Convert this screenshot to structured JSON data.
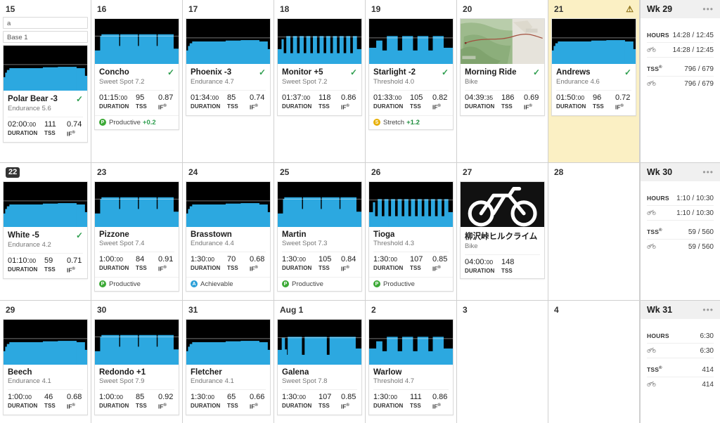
{
  "app": {
    "name": "training-calendar"
  },
  "colors": {
    "graph_bg": "#000000",
    "power_blue": "#2ca8e0",
    "today_highlight": "#fbf0c4",
    "check_green": "#2e9e4f",
    "productive": "#3ba935",
    "achievable": "#2a9fd8",
    "stretch": "#e8b007",
    "warning": "#8a6d12"
  },
  "icons": {
    "check": "✓",
    "warning": "⚠",
    "menu": "•••",
    "bike": "bicycle-icon"
  },
  "labels": {
    "duration": "DURATION",
    "tss": "TSS",
    "if": "IF",
    "if_sup": "®",
    "hours": "HOURS",
    "tss_sup": "®"
  },
  "weeks": [
    {
      "summary": {
        "title": "Wk 29",
        "rows": [
          {
            "label": "HOURS",
            "icon": null,
            "value": "14:28 / 12:45"
          },
          {
            "label": null,
            "icon": "bicycle-icon",
            "value": "14:28 / 12:45"
          },
          {
            "label": "TSS",
            "icon": null,
            "value": "796 / 679",
            "sup": true
          },
          {
            "label": null,
            "icon": "bicycle-icon",
            "value": "796 / 679"
          }
        ]
      },
      "days": [
        {
          "date": "15",
          "today": false,
          "highlight": false,
          "warning": false,
          "annotations": [
            "a",
            "Base 1"
          ],
          "workout": {
            "title": "Polar Bear -3",
            "subtitle": "Endurance 5.6",
            "completed": true,
            "duration": "02:00:",
            "duration_sec": "00",
            "tss": "111",
            "if": "0.74",
            "graph": "endurance-steady",
            "footer": null
          }
        },
        {
          "date": "16",
          "today": false,
          "highlight": false,
          "warning": false,
          "annotations": [],
          "workout": {
            "title": "Concho",
            "subtitle": "Sweet Spot 7.2",
            "completed": true,
            "duration": "01:15:",
            "duration_sec": "00",
            "tss": "95",
            "if": "0.87",
            "graph": "sweetspot-blocks",
            "footer": {
              "type": "Productive",
              "delta": "+0.2",
              "dot": "green"
            }
          }
        },
        {
          "date": "17",
          "today": false,
          "highlight": false,
          "warning": false,
          "annotations": [],
          "workout": {
            "title": "Phoenix -3",
            "subtitle": "Endurance 4.7",
            "completed": true,
            "duration": "01:34:",
            "duration_sec": "00",
            "tss": "85",
            "if": "0.74",
            "graph": "endurance-steady",
            "footer": null
          }
        },
        {
          "date": "18",
          "today": false,
          "highlight": false,
          "warning": false,
          "annotations": [],
          "workout": {
            "title": "Monitor +5",
            "subtitle": "Sweet Spot 7.2",
            "completed": true,
            "duration": "01:37:",
            "duration_sec": "00",
            "tss": "118",
            "if": "0.86",
            "graph": "intervals-narrow",
            "footer": null
          }
        },
        {
          "date": "19",
          "today": false,
          "highlight": false,
          "warning": false,
          "annotations": [],
          "workout": {
            "title": "Starlight -2",
            "subtitle": "Threshold 4.0",
            "completed": true,
            "duration": "01:33:",
            "duration_sec": "00",
            "tss": "105",
            "if": "0.82",
            "graph": "threshold-wide",
            "footer": {
              "type": "Stretch",
              "delta": "+1.2",
              "dot": "amber"
            }
          }
        },
        {
          "date": "20",
          "today": false,
          "highlight": false,
          "warning": false,
          "annotations": [],
          "workout": {
            "title": "Morning Ride",
            "subtitle": "Bike",
            "completed": true,
            "duration": "04:39:",
            "duration_sec": "35",
            "tss": "186",
            "if": "0.69",
            "graph": "map",
            "footer": null
          }
        },
        {
          "date": "21",
          "today": false,
          "highlight": true,
          "warning": true,
          "annotations": [],
          "workout": {
            "title": "Andrews",
            "subtitle": "Endurance 4.6",
            "completed": true,
            "duration": "01:50:",
            "duration_sec": "00",
            "tss": "96",
            "if": "0.72",
            "graph": "endurance-steady",
            "footer": null
          }
        }
      ]
    },
    {
      "summary": {
        "title": "Wk 30",
        "rows": [
          {
            "label": "HOURS",
            "icon": null,
            "value": "1:10 / 10:30"
          },
          {
            "label": null,
            "icon": "bicycle-icon",
            "value": "1:10 / 10:30"
          },
          {
            "label": "TSS",
            "icon": null,
            "value": "59 / 560",
            "sup": true
          },
          {
            "label": null,
            "icon": "bicycle-icon",
            "value": "59 / 560"
          }
        ]
      },
      "days": [
        {
          "date": "22",
          "today": true,
          "highlight": false,
          "warning": false,
          "annotations": [],
          "workout": {
            "title": "White -5",
            "subtitle": "Endurance 4.2",
            "completed": true,
            "duration": "01:10:",
            "duration_sec": "00",
            "tss": "59",
            "if": "0.71",
            "graph": "endurance-steady",
            "footer": null
          }
        },
        {
          "date": "23",
          "today": false,
          "highlight": false,
          "warning": false,
          "annotations": [],
          "workout": {
            "title": "Pizzone",
            "subtitle": "Sweet Spot 7.4",
            "completed": false,
            "duration": "1:00:",
            "duration_sec": "00",
            "tss": "84",
            "if": "0.91",
            "graph": "sweetspot-blocks",
            "footer": {
              "type": "Productive",
              "delta": null,
              "dot": "green"
            }
          }
        },
        {
          "date": "24",
          "today": false,
          "highlight": false,
          "warning": false,
          "annotations": [],
          "workout": {
            "title": "Brasstown",
            "subtitle": "Endurance 4.4",
            "completed": false,
            "duration": "1:30:",
            "duration_sec": "00",
            "tss": "70",
            "if": "0.68",
            "graph": "endurance-steady",
            "footer": {
              "type": "Achievable",
              "delta": null,
              "dot": "blue"
            }
          }
        },
        {
          "date": "25",
          "today": false,
          "highlight": false,
          "warning": false,
          "annotations": [],
          "workout": {
            "title": "Martin",
            "subtitle": "Sweet Spot 7.3",
            "completed": false,
            "duration": "1:30:",
            "duration_sec": "00",
            "tss": "105",
            "if": "0.84",
            "graph": "sweetspot-blocks",
            "footer": {
              "type": "Productive",
              "delta": null,
              "dot": "green"
            }
          }
        },
        {
          "date": "26",
          "today": false,
          "highlight": false,
          "warning": false,
          "annotations": [],
          "workout": {
            "title": "Tioga",
            "subtitle": "Threshold 4.3",
            "completed": false,
            "duration": "1:30:",
            "duration_sec": "00",
            "tss": "107",
            "if": "0.85",
            "graph": "intervals-narrow",
            "footer": {
              "type": "Productive",
              "delta": null,
              "dot": "green"
            }
          }
        },
        {
          "date": "27",
          "today": false,
          "highlight": false,
          "warning": false,
          "annotations": [],
          "workout": {
            "title": "柳沢峠ヒルクライム",
            "subtitle": "Bike",
            "completed": false,
            "duration": "04:00:",
            "duration_sec": "00",
            "tss": "148",
            "if": null,
            "graph": "outdoor",
            "footer": null
          }
        },
        {
          "date": "28",
          "today": false,
          "highlight": false,
          "warning": false,
          "annotations": [],
          "workout": null
        }
      ]
    },
    {
      "summary": {
        "title": "Wk 31",
        "rows": [
          {
            "label": "HOURS",
            "icon": null,
            "value": "6:30"
          },
          {
            "label": null,
            "icon": "bicycle-icon",
            "value": "6:30"
          },
          {
            "label": "TSS",
            "icon": null,
            "value": "414",
            "sup": true
          },
          {
            "label": null,
            "icon": "bicycle-icon",
            "value": "414"
          }
        ]
      },
      "days": [
        {
          "date": "29",
          "today": false,
          "highlight": false,
          "warning": false,
          "annotations": [],
          "workout": {
            "title": "Beech",
            "subtitle": "Endurance 4.1",
            "completed": false,
            "duration": "1:00:",
            "duration_sec": "00",
            "tss": "46",
            "if": "0.68",
            "graph": "endurance-steady",
            "footer": null
          }
        },
        {
          "date": "30",
          "today": false,
          "highlight": false,
          "warning": false,
          "annotations": [],
          "workout": {
            "title": "Redondo +1",
            "subtitle": "Sweet Spot 7.9",
            "completed": false,
            "duration": "1:00:",
            "duration_sec": "00",
            "tss": "85",
            "if": "0.92",
            "graph": "sweetspot-blocks",
            "footer": null
          }
        },
        {
          "date": "31",
          "today": false,
          "highlight": false,
          "warning": false,
          "annotations": [],
          "workout": {
            "title": "Fletcher",
            "subtitle": "Endurance 4.1",
            "completed": false,
            "duration": "1:30:",
            "duration_sec": "00",
            "tss": "65",
            "if": "0.66",
            "graph": "endurance-steady",
            "footer": null
          }
        },
        {
          "date": "Aug 1",
          "today": false,
          "highlight": false,
          "warning": false,
          "annotations": [],
          "workout": {
            "title": "Galena",
            "subtitle": "Sweet Spot 7.8",
            "completed": false,
            "duration": "1:30:",
            "duration_sec": "00",
            "tss": "107",
            "if": "0.85",
            "graph": "sweetspot-gaps",
            "footer": null
          }
        },
        {
          "date": "2",
          "today": false,
          "highlight": false,
          "warning": false,
          "annotations": [],
          "workout": {
            "title": "Warlow",
            "subtitle": "Threshold 4.7",
            "completed": false,
            "duration": "1:30:",
            "duration_sec": "00",
            "tss": "111",
            "if": "0.86",
            "graph": "threshold-wide",
            "footer": null
          }
        },
        {
          "date": "3",
          "today": false,
          "highlight": false,
          "warning": false,
          "annotations": [],
          "workout": null
        },
        {
          "date": "4",
          "today": false,
          "highlight": false,
          "warning": false,
          "annotations": [],
          "workout": null
        }
      ]
    }
  ]
}
